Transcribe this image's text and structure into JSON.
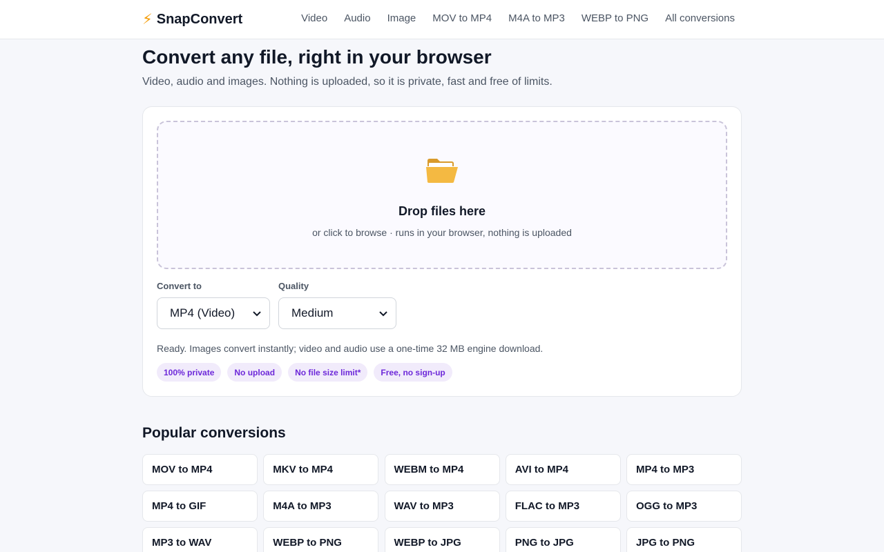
{
  "header": {
    "brand_icon": "lightning-bolt-icon",
    "brand": "SnapConvert",
    "nav": [
      "Video",
      "Audio",
      "Image",
      "MOV to MP4",
      "M4A to MP3",
      "WEBP to PNG",
      "All conversions"
    ]
  },
  "hero": {
    "title": "Convert any file, right in your browser",
    "subtitle": "Video, audio and images. Nothing is uploaded, so it is private, fast and free of limits."
  },
  "dropzone": {
    "icon": "folder-open-icon",
    "title": "Drop files here",
    "subtitle": "or click to browse · runs in your browser, nothing is uploaded"
  },
  "options": {
    "convert_to_label": "Convert to",
    "convert_to_value": "MP4 (Video)",
    "quality_label": "Quality",
    "quality_value": "Medium"
  },
  "status": "Ready. Images convert instantly; video and audio use a one-time 32 MB engine download.",
  "badges": [
    "100% private",
    "No upload",
    "No file size limit*",
    "Free, no sign-up"
  ],
  "popular": {
    "title": "Popular conversions",
    "items": [
      "MOV to MP4",
      "MKV to MP4",
      "WEBM to MP4",
      "AVI to MP4",
      "MP4 to MP3",
      "MP4 to GIF",
      "M4A to MP3",
      "WAV to MP3",
      "FLAC to MP3",
      "OGG to MP3",
      "MP3 to WAV",
      "WEBP to PNG",
      "WEBP to JPG",
      "PNG to JPG",
      "JPG to PNG"
    ]
  },
  "colors": {
    "accent": "#6d28d9",
    "badge_bg": "#f1ebfb",
    "bolt": "#f59e0b"
  }
}
